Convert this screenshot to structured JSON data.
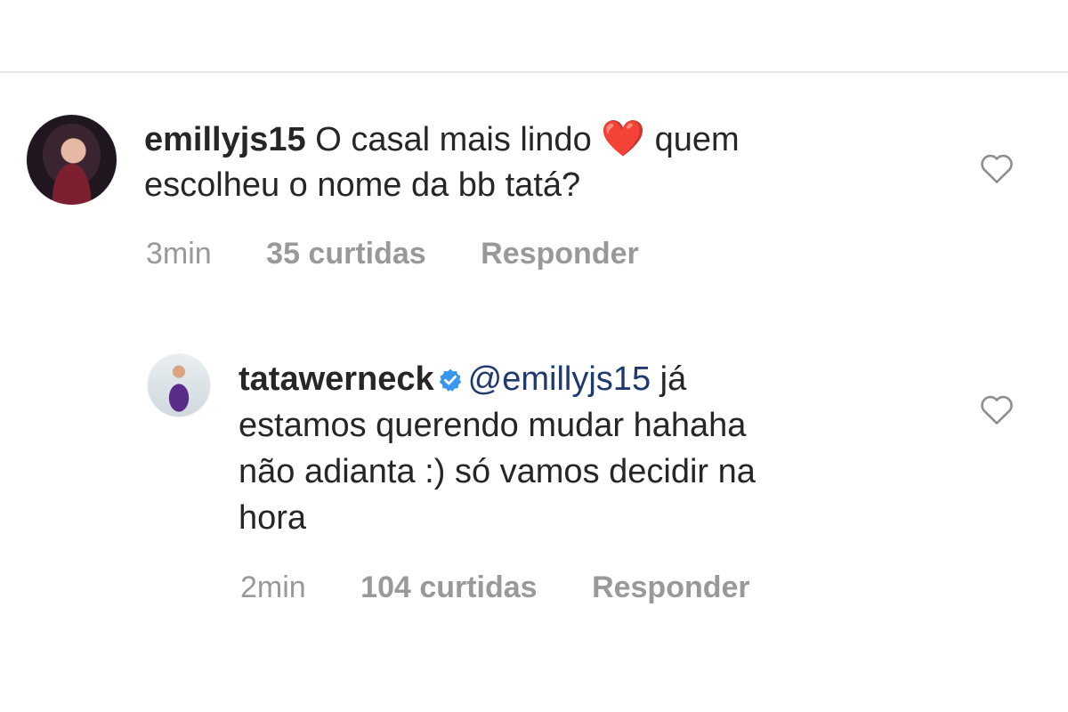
{
  "comments": [
    {
      "username": "emillyjs15",
      "text_part1": " O casal mais lindo ",
      "heart": "❤️",
      "text_part2": " quem",
      "text_line2": "escolheu o nome da bb tatá?",
      "time": "3min",
      "likes": "35 curtidas",
      "reply_label": "Responder"
    },
    {
      "username": "tatawerneck",
      "verified": true,
      "mention": "@emillyjs15",
      "text_part1": " já",
      "text_line2": "estamos querendo mudar hahaha",
      "text_line3": "não adianta :) só vamos decidir na",
      "text_line4": "hora",
      "time": "2min",
      "likes": "104 curtidas",
      "reply_label": "Responder"
    }
  ],
  "colors": {
    "text": "#262626",
    "muted": "#999999",
    "mention": "#1e3a6e",
    "verified": "#3897f0",
    "heart": "#e0182d"
  }
}
